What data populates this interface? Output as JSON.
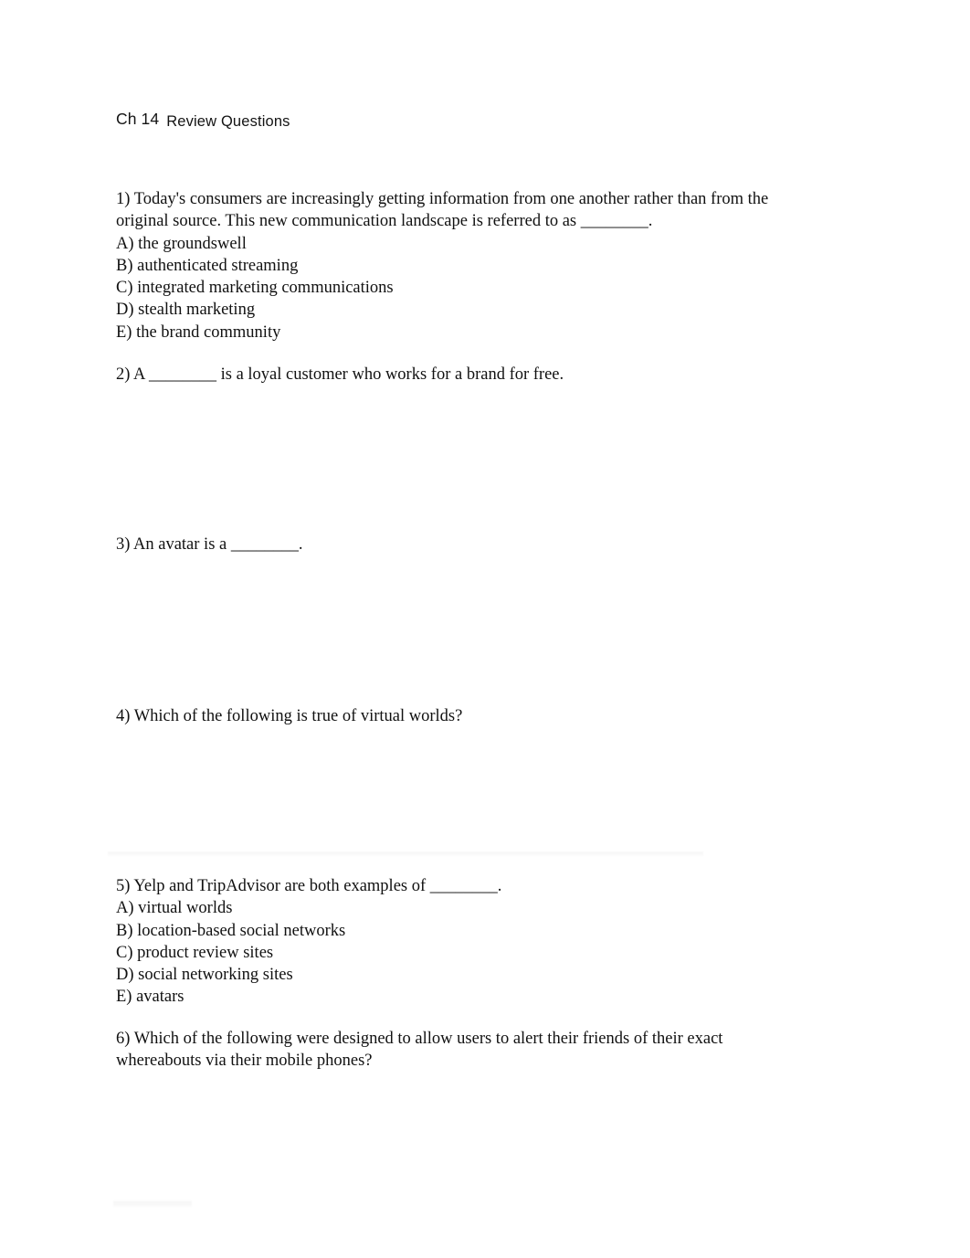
{
  "document": {
    "header": {
      "chapter_label": "Ch 14",
      "title": "Review Questions"
    },
    "page_background": "#ffffff",
    "text_color": "#111111"
  },
  "questions": [
    {
      "number": "1",
      "lines": [
        "1) Today's consumers are increasingly getting information from one another rather than from the",
        "original source. This new communication landscape is referred to as ________."
      ],
      "options": [
        "A) the groundswell",
        "B) authenticated streaming",
        "C) integrated marketing communications",
        "D) stealth marketing",
        "E) the brand community"
      ]
    },
    {
      "number": "2",
      "lines": [
        "2) A ________ is a loyal customer who works for a brand for free."
      ],
      "options": []
    },
    {
      "number": "3",
      "lines": [
        "3) An avatar is a ________."
      ],
      "options": []
    },
    {
      "number": "4",
      "lines": [
        "4) Which of the following is true of virtual worlds?"
      ],
      "options": []
    },
    {
      "number": "5",
      "lines": [
        "5) Yelp and TripAdvisor are both examples of ________."
      ],
      "options": [
        "A) virtual worlds",
        "B) location-based social networks",
        "C) product review sites",
        "D) social networking sites",
        "E) avatars"
      ]
    },
    {
      "number": "6",
      "lines": [
        "6) Which of the following were designed to allow users to alert their friends of their exact",
        "whereabouts via their mobile phones?"
      ],
      "options": []
    }
  ]
}
